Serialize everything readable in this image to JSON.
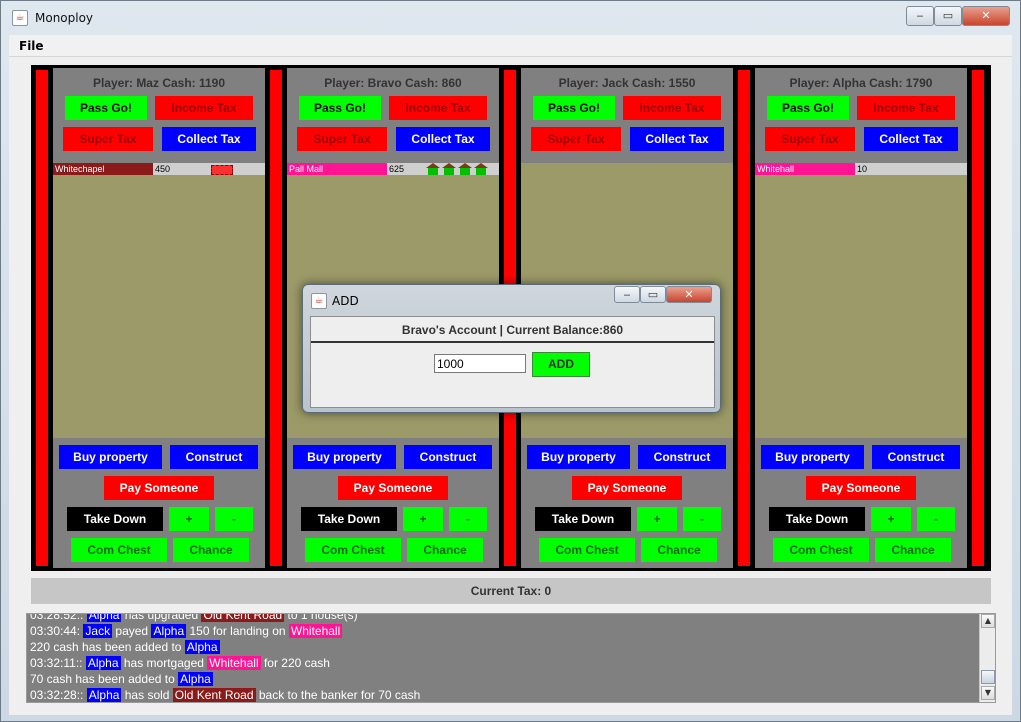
{
  "window": {
    "title": "Monoploy",
    "icon": "java-cup-icon",
    "controls": {
      "minimize": "‒",
      "maximize": "▭",
      "close": "✕"
    }
  },
  "menu": {
    "file": "File"
  },
  "buttons": {
    "pass_go": "Pass Go!",
    "income_tax": "Income Tax",
    "super_tax": "Super Tax",
    "collect_tax": "Collect Tax",
    "buy_property": "Buy property",
    "construct": "Construct",
    "pay_someone": "Pay Someone",
    "take_down": "Take Down",
    "plus": "+",
    "minus": "-",
    "com_chest": "Com Chest",
    "chance": "Chance"
  },
  "players": [
    {
      "header": "Player: Maz    Cash: 1190",
      "properties": [
        {
          "name": "Whitechapel",
          "value": "450",
          "color": "#8b1a1a",
          "buildings": "hotel"
        }
      ]
    },
    {
      "header": "Player: Bravo    Cash: 860",
      "properties": [
        {
          "name": "Pall Mall",
          "value": "625",
          "color": "#ff1493",
          "buildings": "4 houses"
        }
      ]
    },
    {
      "header": "Player: Jack    Cash: 1550",
      "properties": []
    },
    {
      "header": "Player: Alpha    Cash: 1790",
      "properties": [
        {
          "name": "Whitehall",
          "value": "10",
          "color": "#ff1493",
          "buildings": "none"
        }
      ]
    }
  ],
  "tax_bar": "Current Tax: 0",
  "log": {
    "lines": [
      {
        "segments": [
          {
            "t": "03:28:52:: "
          },
          {
            "t": "Alpha",
            "hl": "blue"
          },
          {
            "t": " has upgraded "
          },
          {
            "t": "Old Kent Road",
            "hl": "brown"
          },
          {
            "t": " to 1 house(s)"
          }
        ]
      },
      {
        "segments": [
          {
            "t": "03:30:44: "
          },
          {
            "t": "Jack",
            "hl": "blue"
          },
          {
            "t": " payed "
          },
          {
            "t": "Alpha",
            "hl": "blue"
          },
          {
            "t": " 150 for landing on "
          },
          {
            "t": "Whitehall",
            "hl": "pink"
          }
        ]
      },
      {
        "segments": [
          {
            "t": "220 cash has been added to "
          },
          {
            "t": "Alpha",
            "hl": "blue"
          }
        ]
      },
      {
        "segments": [
          {
            "t": "03:32:11:: "
          },
          {
            "t": "Alpha",
            "hl": "blue"
          },
          {
            "t": " has mortgaged "
          },
          {
            "t": "Whitehall",
            "hl": "pink"
          },
          {
            "t": " for 220 cash"
          }
        ]
      },
      {
        "segments": [
          {
            "t": "70 cash has been added to "
          },
          {
            "t": "Alpha",
            "hl": "blue"
          }
        ]
      },
      {
        "segments": [
          {
            "t": "03:32:28:: "
          },
          {
            "t": "Alpha",
            "hl": "blue"
          },
          {
            "t": " has sold "
          },
          {
            "t": "Old Kent Road",
            "hl": "brown"
          },
          {
            "t": " back to the banker for 70 cash"
          }
        ]
      }
    ]
  },
  "dialog": {
    "title": "ADD",
    "header": "Bravo's Account | Current Balance:860",
    "input_value": "1000",
    "add_button": "ADD"
  },
  "colors": {
    "panel_bg": "#808080",
    "property_area": "#9b9a68",
    "green_btn": "#00ff00",
    "red_btn": "#ff0000",
    "blue_btn": "#0000ff"
  }
}
